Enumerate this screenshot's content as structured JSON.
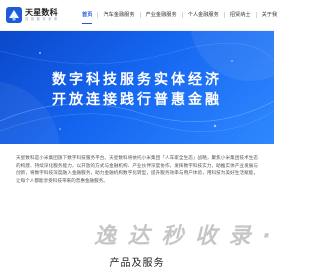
{
  "header": {
    "brand": "天星数科",
    "brand_sub": "共 创 数 字 未 来",
    "nav": [
      "首页",
      "汽车金融服务",
      "产业金融服务",
      "个人金融服务",
      "招贤纳士",
      "关于我"
    ]
  },
  "hero": {
    "line1": "数字科技服务实体经济",
    "line2": "开放连接践行普惠金融"
  },
  "intro": {
    "text": "天星数科是小米集团旗下数字科技服务平台。天星数科将依托小米集团「人车家全生态」战略，聚焦小米集团技术生态的构建、持续深化服务能力，以开放的方式与金融机构、产业伙伴深度协作，发挥数字科技实力，助推实体产业发展与创新，将数字科技深度融入金融服务，助力金融机构数字化转型，提升服务效率与用户体验，用科技为美好生活赋能，让每个人都能享受科技带来的普惠金融服务。"
  },
  "watermark": {
    "text": "逸 达 秒 收 录 · 秒"
  },
  "section": {
    "title": "产品及服务"
  },
  "colors": {
    "accent": "#1f5bd6",
    "hero_start": "#0b47c9",
    "hero_end": "#2f88ff"
  }
}
